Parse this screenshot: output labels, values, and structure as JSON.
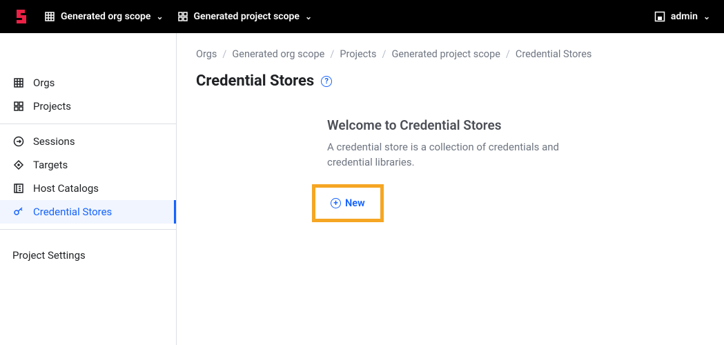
{
  "header": {
    "org_scope_label": "Generated org scope",
    "project_scope_label": "Generated project scope",
    "user_label": "admin"
  },
  "sidebar": {
    "items": [
      {
        "label": "Orgs"
      },
      {
        "label": "Projects"
      },
      {
        "label": "Sessions"
      },
      {
        "label": "Targets"
      },
      {
        "label": "Host Catalogs"
      },
      {
        "label": "Credential Stores"
      }
    ],
    "settings_label": "Project Settings"
  },
  "breadcrumb": {
    "items": [
      "Orgs",
      "Generated org scope",
      "Projects",
      "Generated project scope",
      "Credential Stores"
    ]
  },
  "page": {
    "title": "Credential Stores",
    "empty_title": "Welcome to Credential Stores",
    "empty_desc": "A credential store is a collection of credentials and credential libraries.",
    "new_label": "New"
  }
}
